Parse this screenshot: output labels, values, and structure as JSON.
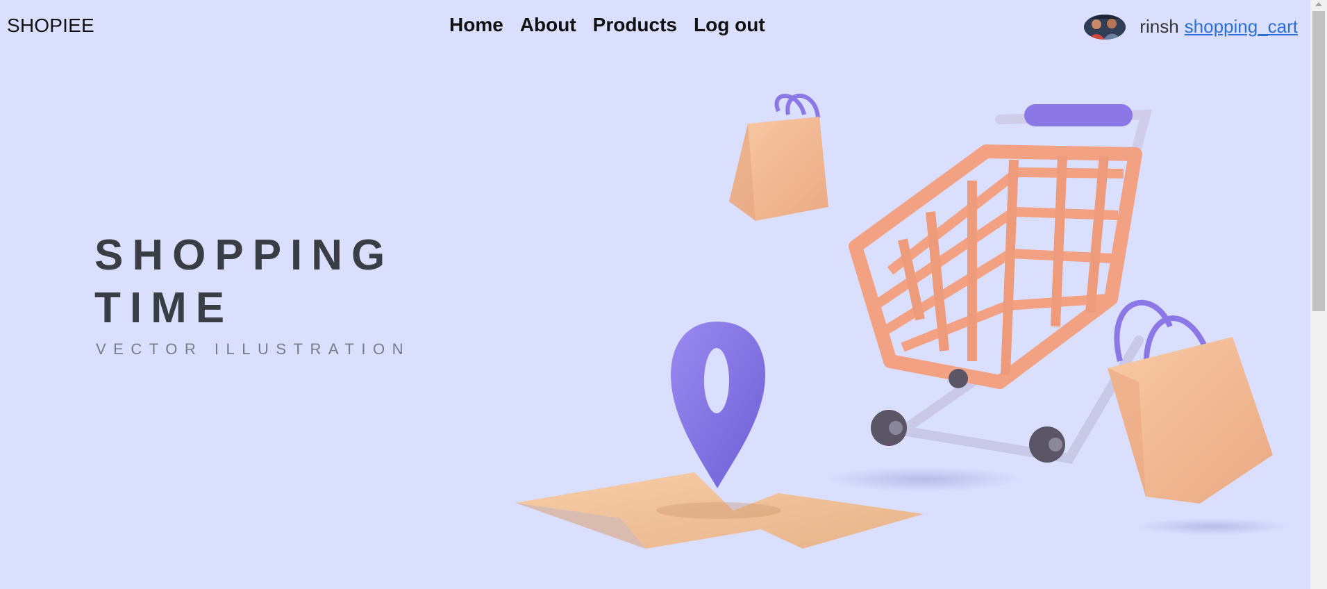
{
  "nav": {
    "brand": "SHOPIEE",
    "links": [
      {
        "label": "Home"
      },
      {
        "label": "About"
      },
      {
        "label": "Products"
      },
      {
        "label": "Log out"
      }
    ],
    "user": {
      "name": "rinsh",
      "cart_link": "shopping_cart"
    }
  },
  "hero": {
    "title_line1": "SHOPPING",
    "title_line2": "TIME",
    "subtitle": "VECTOR ILLUSTRATION",
    "illustration_icons": [
      "shopping-bag-icon",
      "shopping-cart-icon",
      "map-pin-icon",
      "folded-map-icon"
    ]
  },
  "colors": {
    "background": "#dadffe",
    "cart_orange": "#f2a183",
    "bag_peach": "#f5c39e",
    "accent_purple": "#8b78e6",
    "link_blue": "#2b6fd6"
  }
}
